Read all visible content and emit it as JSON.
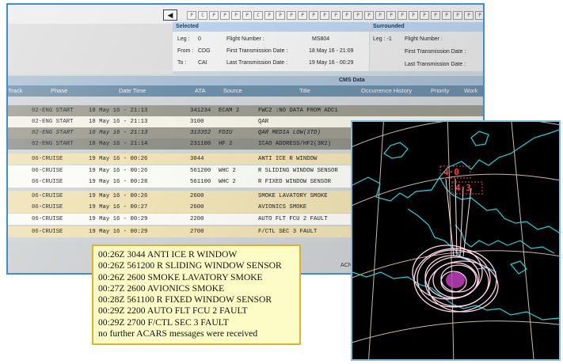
{
  "cms": {
    "nav_prev": "◀",
    "flags": [
      "P",
      "C",
      "P",
      "P",
      "P",
      "P",
      "C",
      "P",
      "P",
      "P",
      "P",
      "P",
      "P",
      "P",
      "P",
      "P",
      "P",
      "P",
      "P",
      "P",
      "P",
      "P",
      "P",
      "P",
      "P",
      "P",
      "P",
      "P",
      "P",
      "P",
      "P",
      "P",
      "P",
      "P"
    ],
    "selected": {
      "title": "Selected",
      "leg_label": "Leg :",
      "leg_value": "0",
      "flight_number_label": "Flight Number :",
      "flight_number_value": "MS804",
      "from_label": "From :",
      "from_value": "CDG",
      "first_tx_label": "First Transmission Date :",
      "first_tx_value": "18 May 16 - 21:09",
      "to_label": "To :",
      "to_value": "CAI",
      "last_tx_label": "Last Transmission Date :",
      "last_tx_value": "19 May 16 - 00:29"
    },
    "surrounded": {
      "title": "Surrounded",
      "leg_label": "Leg : -1",
      "flight_number_label": "Flight Number :",
      "first_tx_label": "First Transmission Date :",
      "last_tx_label": "Last Transmission Date :"
    },
    "section_title": "CMS Data",
    "columns": [
      "Track",
      "Phase",
      "Date Time",
      "ATA",
      "Source",
      "Title",
      "Occurrence History",
      "Priority",
      "Work"
    ],
    "rows": [
      {
        "phase": "02-ENG START",
        "datetime": "18 May 16 - 21:13",
        "ata": "341234",
        "source": "ECAM 2",
        "title": "FWC2 :NO DATA FROM ADC1"
      },
      {
        "phase": "02-ENG START",
        "datetime": "18 May 16 - 21:13",
        "ata": "3100",
        "source": "",
        "title": "QAR"
      },
      {
        "phase": "02-ENG START",
        "datetime": "18 May 16 - 21:13",
        "ata": "313352",
        "source": "FDIU",
        "title": "QAR MEDIA LOW(3TD)"
      },
      {
        "phase": "02-ENG START",
        "datetime": "18 May 16 - 21:14",
        "ata": "231100",
        "source": "HF 2",
        "title": "ICAO ADDRESS/HF2(3R2)"
      },
      {
        "phase": "06-CRUISE",
        "datetime": "19 May 16 - 00:26",
        "ata": "3044",
        "source": "",
        "title": "ANTI ICE R WINDOW"
      },
      {
        "phase": "06-CRUISE",
        "datetime": "19 May 16 - 00:26",
        "ata": "561200",
        "source": "WHC 2",
        "title": "R SLIDING WINDOW SENSOR"
      },
      {
        "phase": "06-CRUISE",
        "datetime": "19 May 16 - 00:28",
        "ata": "561100",
        "source": "WHC 2",
        "title": "R FIXED WINDOW SENSOR"
      },
      {
        "phase": "06-CRUISE",
        "datetime": "19 May 16 - 00:26",
        "ata": "2600",
        "source": "",
        "title": "SMOKE LAVATORY SMOKE"
      },
      {
        "phase": "06-CRUISE",
        "datetime": "19 May 16 - 00:27",
        "ata": "2600",
        "source": "",
        "title": "AVIONICS SMOKE"
      },
      {
        "phase": "06-CRUISE",
        "datetime": "19 May 16 - 00:29",
        "ata": "2200",
        "source": "",
        "title": "AUTO FLT FCU 2 FAULT"
      },
      {
        "phase": "06-CRUISE",
        "datetime": "19 May 16 - 00:29",
        "ata": "2700",
        "source": "",
        "title": "F/CTL SEC 3 FAULT"
      }
    ],
    "footer_partial": "ACN"
  },
  "acars": {
    "lines": [
      "00:26Z 3044 ANTI ICE R WINDOW",
      "00:26Z 561200 R SLIDING WINDOW SENSOR",
      "00:26Z 2600 SMOKE LAVATORY SMOKE",
      "00:27Z 2600 AVIONICS SMOKE",
      "00:28Z 561100 R FIXED WINDOW SENSOR",
      "00:29Z 2200 AUTO FLT FCU 2 FAULT",
      "00:29Z 2700 F/CTL SEC 3 FAULT",
      "no further ACARS messages were received"
    ],
    "border_color": "#e0b324",
    "background_color": "#fefcc6"
  },
  "map": {
    "label_top": "4·0",
    "label_bottom": "4·3",
    "coast_color": "#19d6e0",
    "grid_color": "#f0d8c8",
    "rings_color": "#ffd6e8",
    "label_color": "#ff4040"
  }
}
